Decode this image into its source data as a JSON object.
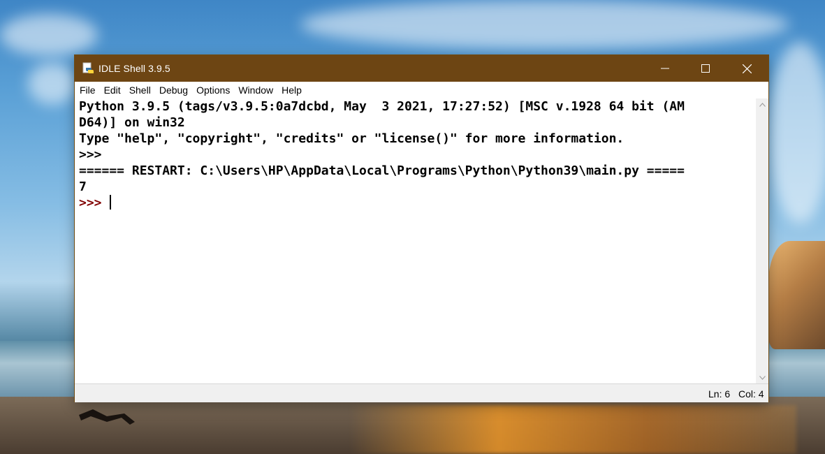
{
  "window": {
    "title": "IDLE Shell 3.9.5",
    "icons": [
      "python-idle-icon",
      "minimize-icon",
      "maximize-icon",
      "close-icon"
    ]
  },
  "menubar": {
    "items": [
      "File",
      "Edit",
      "Shell",
      "Debug",
      "Options",
      "Window",
      "Help"
    ]
  },
  "shell": {
    "lines": [
      {
        "text": "Python 3.9.5 (tags/v3.9.5:0a7dcbd, May  3 2021, 17:27:52) [MSC v.1928 64 bit (AM",
        "kind": "output"
      },
      {
        "text": "D64)] on win32",
        "kind": "output"
      },
      {
        "text": "Type \"help\", \"copyright\", \"credits\" or \"license()\" for more information.",
        "kind": "output"
      },
      {
        "text": ">>>",
        "kind": "prompt"
      },
      {
        "text": "====== RESTART: C:\\Users\\HP\\AppData\\Local\\Programs\\Python\\Python39\\main.py =====",
        "kind": "output"
      },
      {
        "text": "7",
        "kind": "stdout"
      },
      {
        "text": ">>> ",
        "kind": "prompt"
      }
    ]
  },
  "statusbar": {
    "line": "Ln: 6",
    "col": "Col: 4"
  },
  "colors": {
    "titlebar": "#6d4513",
    "prompt": "#800000",
    "stdout": "#0000c0"
  }
}
